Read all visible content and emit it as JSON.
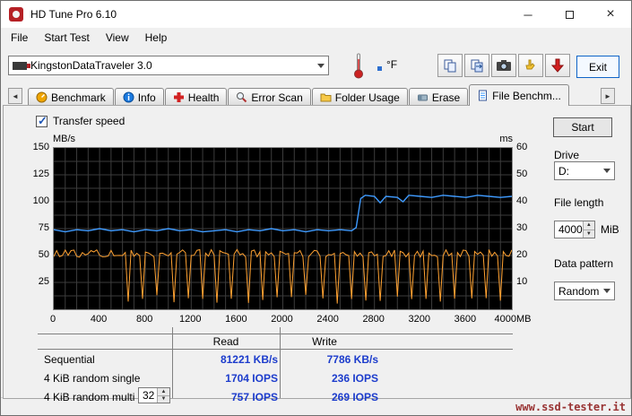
{
  "window": {
    "title": "HD Tune Pro 6.10"
  },
  "menu": {
    "items": [
      "File",
      "Start Test",
      "View",
      "Help"
    ]
  },
  "toolbar": {
    "device": "KingstonDataTraveler 3.0",
    "temp_unit": "°F",
    "exit_label": "Exit"
  },
  "tabs": [
    {
      "label": "Benchmark"
    },
    {
      "label": "Info"
    },
    {
      "label": "Health"
    },
    {
      "label": "Error Scan"
    },
    {
      "label": "Folder Usage"
    },
    {
      "label": "Erase"
    },
    {
      "label": "File Benchm...",
      "active": true
    }
  ],
  "panel": {
    "checkbox_label": "Transfer speed",
    "checked": true
  },
  "controls": {
    "start_label": "Start",
    "drive_label": "Drive",
    "drive_value": "D:",
    "file_length_label": "File length",
    "file_length_value": "4000",
    "file_length_unit": "MiB",
    "data_pattern_label": "Data pattern",
    "data_pattern_value": "Random"
  },
  "results": {
    "columns": [
      "Read",
      "Write"
    ],
    "rows": [
      {
        "label": "Sequential",
        "read": "81221 KB/s",
        "write": "7786 KB/s"
      },
      {
        "label": "4 KiB random single",
        "read": "1704 IOPS",
        "write": "236 IOPS"
      },
      {
        "label": "4 KiB random multi",
        "spinner": "32",
        "read": "757 IOPS",
        "write": "269 IOPS"
      }
    ]
  },
  "statusbar": {
    "text": "www.ssd-tester.it"
  },
  "chart_data": {
    "type": "line",
    "title": "File benchmark transfer speed",
    "axes": {
      "x_max": 4000,
      "x_ticks": [
        0,
        400,
        800,
        1200,
        1600,
        2000,
        2400,
        2800,
        3200,
        3600
      ],
      "x_last": "4000MB",
      "y_left_label": "MB/s",
      "y_left_max": 150,
      "y_left_ticks": [
        150,
        125,
        100,
        75,
        50,
        25
      ],
      "y_right_label": "ms",
      "y_right_max": 60,
      "y_right_ticks": [
        60,
        50,
        40,
        30,
        20,
        10
      ],
      "grid_x_step": 100,
      "grid_y_step": 12.5,
      "grid_on": true
    },
    "series": [
      {
        "name": "read-transfer-speed-MBps",
        "color": "#3f9bff",
        "points": [
          [
            0,
            74
          ],
          [
            100,
            72
          ],
          [
            200,
            74
          ],
          [
            300,
            73
          ],
          [
            400,
            75
          ],
          [
            500,
            73
          ],
          [
            600,
            74
          ],
          [
            700,
            72
          ],
          [
            800,
            74
          ],
          [
            900,
            73
          ],
          [
            1000,
            75
          ],
          [
            1100,
            73
          ],
          [
            1200,
            74
          ],
          [
            1300,
            72
          ],
          [
            1400,
            73
          ],
          [
            1500,
            74
          ],
          [
            1600,
            72
          ],
          [
            1700,
            74
          ],
          [
            1800,
            73
          ],
          [
            1900,
            75
          ],
          [
            2000,
            73
          ],
          [
            2100,
            74
          ],
          [
            2200,
            72
          ],
          [
            2300,
            74
          ],
          [
            2400,
            73
          ],
          [
            2500,
            74
          ],
          [
            2600,
            73
          ],
          [
            2640,
            76
          ],
          [
            2680,
            103
          ],
          [
            2720,
            106
          ],
          [
            2800,
            105
          ],
          [
            2850,
            99
          ],
          [
            2900,
            105
          ],
          [
            3000,
            104
          ],
          [
            3050,
            100
          ],
          [
            3100,
            106
          ],
          [
            3200,
            105
          ],
          [
            3300,
            104
          ],
          [
            3400,
            106
          ],
          [
            3500,
            105
          ],
          [
            3600,
            104
          ],
          [
            3700,
            106
          ],
          [
            3800,
            105
          ],
          [
            3900,
            104
          ],
          [
            4000,
            105
          ]
        ]
      },
      {
        "name": "write-activity-spiky-trace",
        "color": "#ffa232",
        "gen": {
          "base": 52,
          "noise": 3.5,
          "spike_start": 650,
          "spike_interval": 130,
          "spike_low_min": 5,
          "spike_low_max": 14,
          "sample_step": 25,
          "x_max": 4000
        }
      }
    ]
  }
}
